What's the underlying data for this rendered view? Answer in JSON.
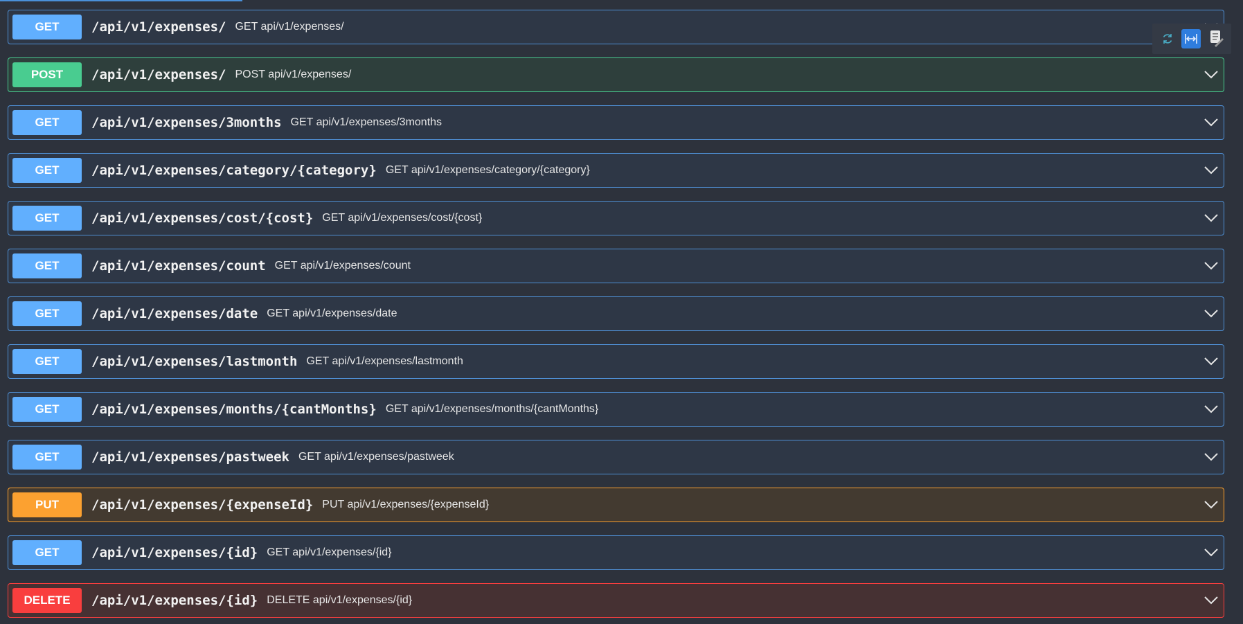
{
  "operations": [
    {
      "method": "GET",
      "variant": "get",
      "path": "/api/v1/expenses/",
      "summary": "GET api/v1/expenses/"
    },
    {
      "method": "POST",
      "variant": "post",
      "path": "/api/v1/expenses/",
      "summary": "POST api/v1/expenses/"
    },
    {
      "method": "GET",
      "variant": "get",
      "path": "/api/v1/expenses/3months",
      "summary": "GET api/v1/expenses/3months"
    },
    {
      "method": "GET",
      "variant": "get",
      "path": "/api/v1/expenses/category/{category}",
      "summary": "GET api/v1/expenses/category/{category}"
    },
    {
      "method": "GET",
      "variant": "get",
      "path": "/api/v1/expenses/cost/{cost}",
      "summary": "GET api/v1/expenses/cost/{cost}"
    },
    {
      "method": "GET",
      "variant": "get",
      "path": "/api/v1/expenses/count",
      "summary": "GET api/v1/expenses/count"
    },
    {
      "method": "GET",
      "variant": "get",
      "path": "/api/v1/expenses/date",
      "summary": "GET api/v1/expenses/date"
    },
    {
      "method": "GET",
      "variant": "get",
      "path": "/api/v1/expenses/lastmonth",
      "summary": "GET api/v1/expenses/lastmonth"
    },
    {
      "method": "GET",
      "variant": "get",
      "path": "/api/v1/expenses/months/{cantMonths}",
      "summary": "GET api/v1/expenses/months/{cantMonths}"
    },
    {
      "method": "GET",
      "variant": "get",
      "path": "/api/v1/expenses/pastweek",
      "summary": "GET api/v1/expenses/pastweek"
    },
    {
      "method": "PUT",
      "variant": "put",
      "path": "/api/v1/expenses/{expenseId}",
      "summary": "PUT api/v1/expenses/{expenseId}"
    },
    {
      "method": "GET",
      "variant": "get",
      "path": "/api/v1/expenses/{id}",
      "summary": "GET api/v1/expenses/{id}"
    },
    {
      "method": "DELETE",
      "variant": "delete",
      "path": "/api/v1/expenses/{id}",
      "summary": "DELETE api/v1/expenses/{id}"
    }
  ],
  "toolbar": {
    "icons": [
      "refresh-icon",
      "fit-width-icon",
      "document-icon"
    ]
  },
  "colors": {
    "background": "#2d323c",
    "get": "#61affe",
    "post": "#49cc90",
    "put": "#fca130",
    "delete": "#f93e3e"
  }
}
